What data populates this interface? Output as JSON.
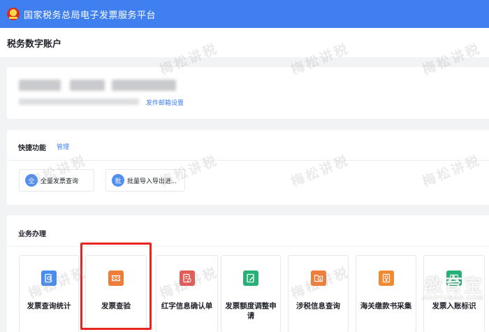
{
  "app": {
    "platform_title": "国家税务总局电子发票服务平台",
    "page_title": "税务数字账户"
  },
  "account": {
    "mail_settings_link": "发件邮箱设置"
  },
  "quick": {
    "title": "快捷功能",
    "manage_label": "管理",
    "items": [
      {
        "badge": "全",
        "label": "全量发票查询"
      },
      {
        "badge": "批",
        "label": "批量导入导出进..."
      }
    ]
  },
  "business": {
    "title": "业务办理",
    "tiles": [
      {
        "label": "发票查询统计",
        "icon": "search-doc-icon",
        "color": "#4a8df0"
      },
      {
        "label": "发票查验",
        "icon": "ticket-icon",
        "color": "#ef7d3a"
      },
      {
        "label": "红字信息确认单",
        "icon": "red-invoice-icon",
        "color": "#e25b56"
      },
      {
        "label": "发票额度调整申请",
        "icon": "edit-doc-icon",
        "color": "#27b077"
      },
      {
        "label": "涉税信息查询",
        "icon": "folder-search-icon",
        "color": "#f07f3b"
      },
      {
        "label": "海关缴款书采集",
        "icon": "customs-doc-icon",
        "color": "#f08a33"
      },
      {
        "label": "发票入账标识",
        "icon": "bookkeeping-icon",
        "color": "#27b077"
      }
    ]
  },
  "watermark": {
    "text": "梅松讲税"
  },
  "brand": {
    "cn": "教育宝",
    "en": "JIAOYUBAO.COM"
  }
}
